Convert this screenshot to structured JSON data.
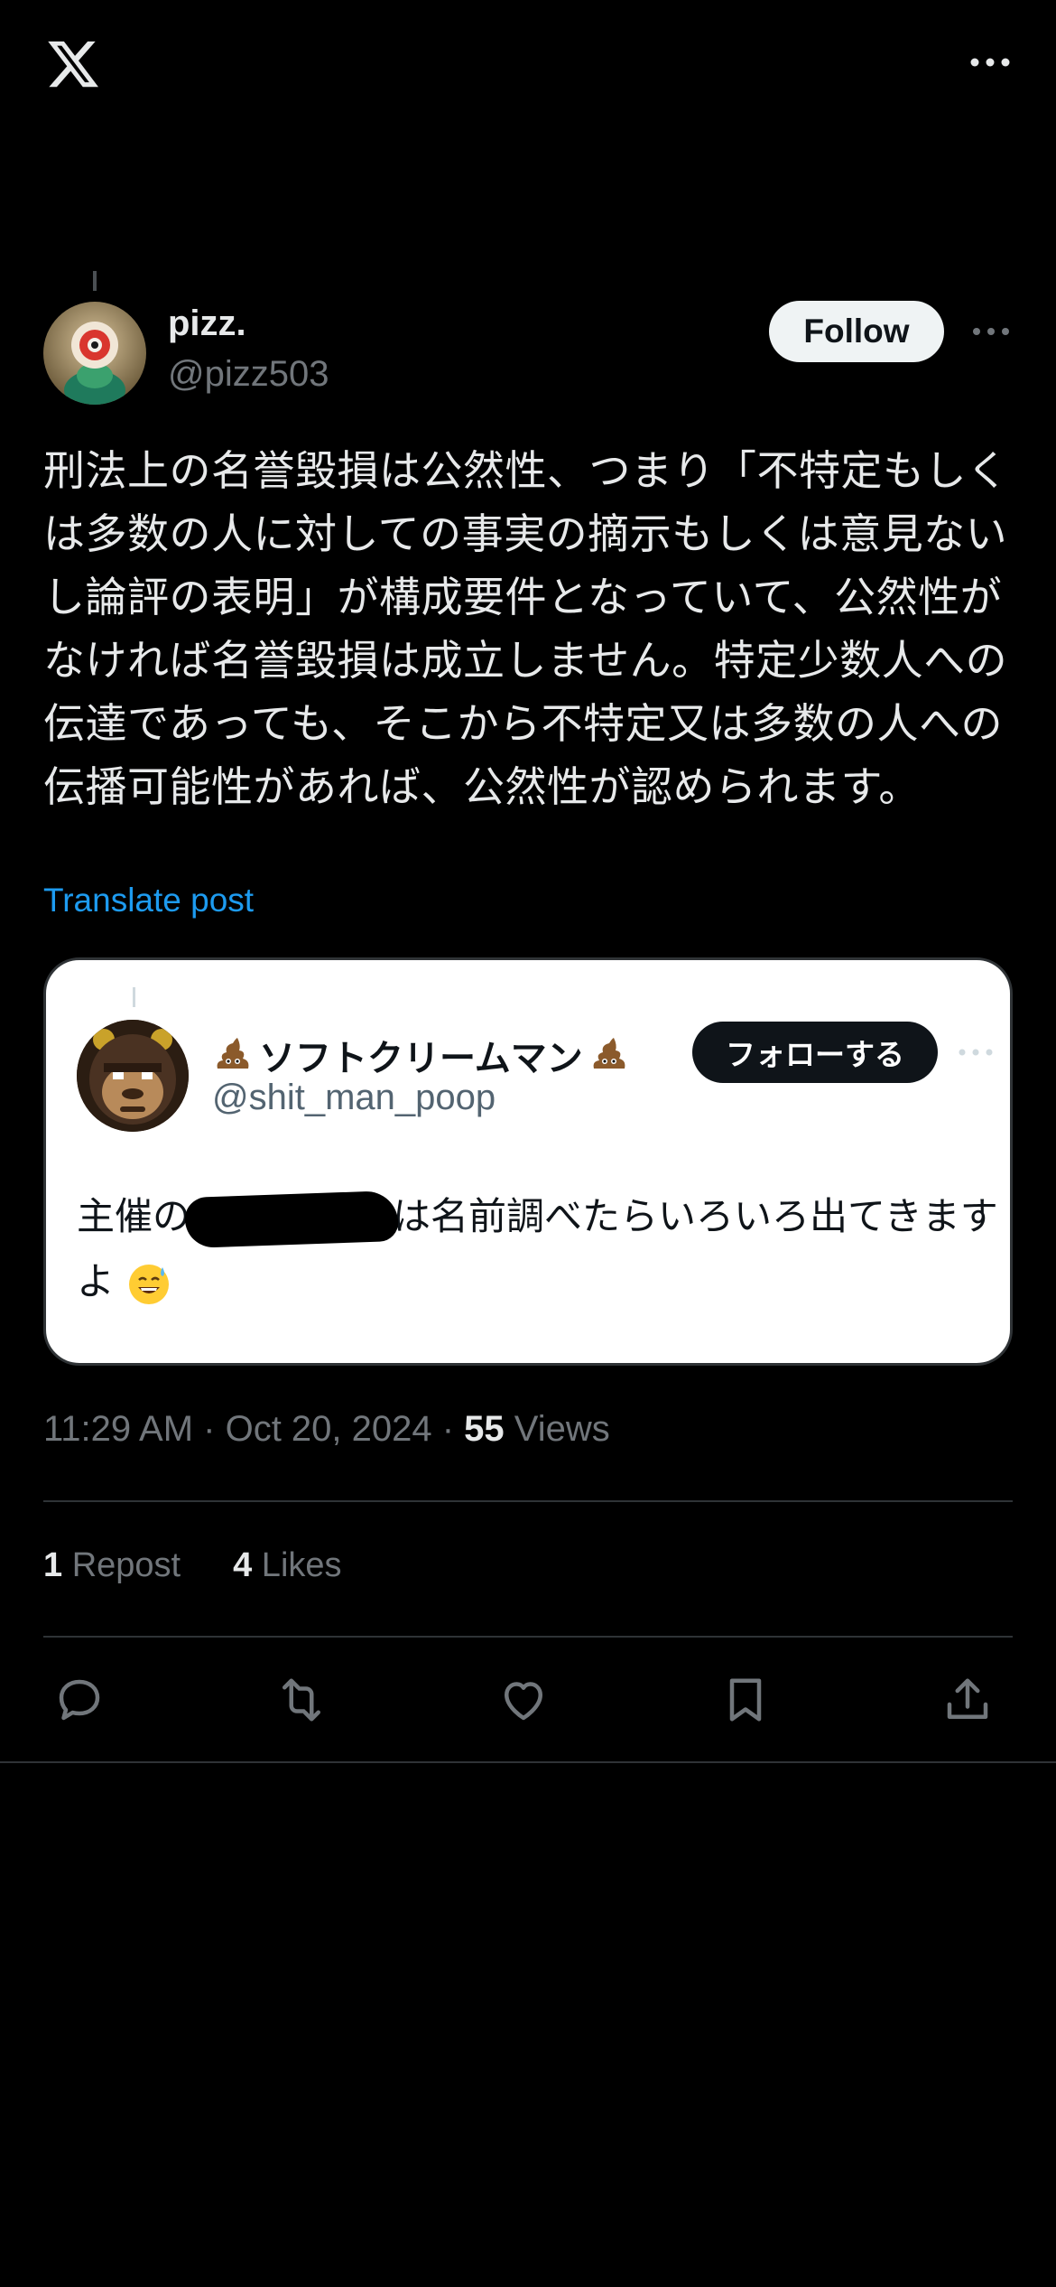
{
  "app": {
    "logo": "x-logo-icon"
  },
  "post": {
    "author_name": "pizz.",
    "author_handle": "@pizz503",
    "follow_label": "Follow",
    "text": "刑法上の名誉毀損は公然性、つまり「不特定もしくは多数の人に対しての事実の摘示もしくは意見ないし論評の表明」が構成要件となっていて、公然性がなければ名誉毀損は成立しません。特定少数人への伝達であっても、そこから不特定又は多数の人への伝播可能性があれば、公然性が認められます。",
    "translate_label": "Translate post",
    "time": "11:29 AM · Oct 20, 2024 · ",
    "views_count": "55",
    "views_label": " Views",
    "reposts_count": "1",
    "reposts_label": " Repost",
    "likes_count": "4",
    "likes_label": " Likes"
  },
  "quote": {
    "name_text": "ソフトクリームマン",
    "handle": "@shit_man_poop",
    "follow_label": "フォローする",
    "text_before": "主催の",
    "text_after": "は名前調べたらいろいろ出てきますよ",
    "emoji": "sweat-smile-emoji"
  },
  "actions": [
    "reply-icon",
    "repost-icon",
    "like-icon",
    "bookmark-icon",
    "share-icon"
  ],
  "colors": {
    "accent": "#1d9bf0",
    "background": "#000000",
    "muted": "#71767b"
  }
}
